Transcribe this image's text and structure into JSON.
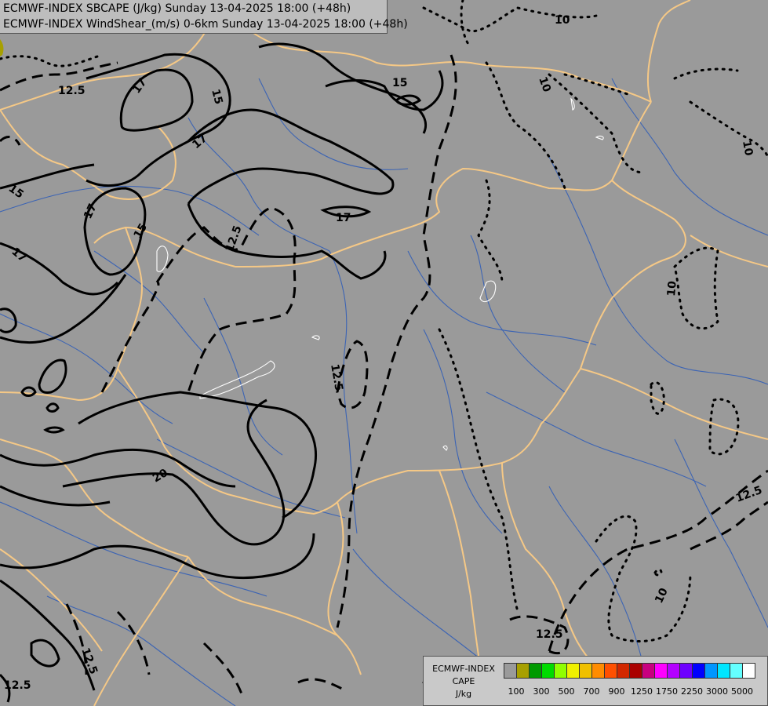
{
  "titles": {
    "line1": "ECMWF-INDEX SBCAPE (J/kg) Sunday 13-04-2025 18:00 (+48h)",
    "line2": "ECMWF-INDEX WindShear_(m/s) 0-6km Sunday 13-04-2025 18:00 (+48h)"
  },
  "legend": {
    "line1": "ECMWF-INDEX",
    "line2": "CAPE",
    "line3": "J/kg",
    "colors": [
      "#9a9a9a",
      "#a7a000",
      "#009a00",
      "#00dc00",
      "#90ff00",
      "#f0f000",
      "#f0c000",
      "#ff8c00",
      "#ff5000",
      "#d22800",
      "#aa0000",
      "#c8007f",
      "#ff00ff",
      "#b400ff",
      "#6e00ff",
      "#0000ff",
      "#0096ff",
      "#00e6ff",
      "#64ffff",
      "#ffffff"
    ],
    "ticks": [
      "100",
      "300",
      "500",
      "700",
      "900",
      "1250",
      "1750",
      "2250",
      "3000",
      "5000"
    ]
  },
  "contour_labels": [
    "17",
    "15",
    "12.5",
    "17",
    "17",
    "15",
    "17",
    "15",
    "12.5",
    "10",
    "10",
    "10",
    "10",
    "12.5",
    "10",
    "12.5",
    "12.5",
    "20",
    "12.5",
    "15",
    "17",
    "12.5"
  ]
}
